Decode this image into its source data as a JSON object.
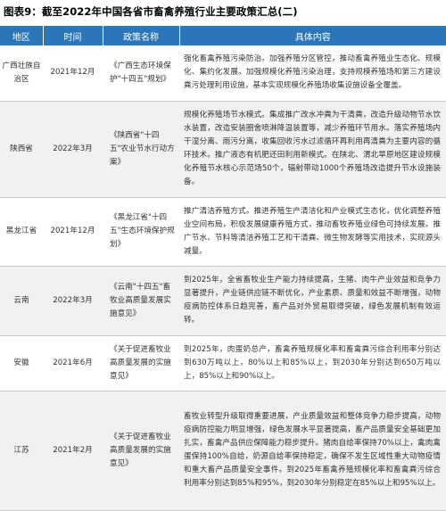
{
  "title": "图表9：截至2022年中国各省市畜禽养殖行业主要政策汇总(二)",
  "table": {
    "headers": [
      "地区",
      "时间",
      "政策名称",
      "具体内容"
    ],
    "rows": [
      {
        "region": "广西壮族自治区",
        "time": "2021年12月",
        "policy": "《广西生态环境保护\"十四五\"规划》",
        "content": "强化畜禽养殖污染防治。加强养殖分区管控，推动畜禽养殖业生态化、规模化、集约化发展。加强规模化养殖污染治理，支持规模养殖场和第三方建设粪污处理利用设施，基本实现规模化养殖场收集设施设备全覆盖。"
      },
      {
        "region": "陕西省",
        "time": "2022年3月",
        "policy": "《陕西省\"十四五\"农业节水行动方案》",
        "content": "规模化养殖场节水模式。集成推广改水冲粪为干清粪，改造升级动物节水饮水装置，改造安装圈舍喷淋降温装置等，减少养殖环节用水。落实养殖场内干湿分离、雨污分离，收集回收污水过滤循环再利用再清粪为主要内容的循环技术。推广液态有机肥还田利用新模式。在陕北、渭北旱原地区建设规模化养殖节水核心示范场50个，辐射带动1000个养殖场改造提升节水设施装备。"
      },
      {
        "region": "黑龙江省",
        "time": "2021年12月",
        "policy": "《黑龙江省\"十四五\"生态环境保护规划》",
        "content": "推广清洁养殖方式。推进养殖生产清洁化和产业模式生态化，优化调整养殖业空间布局，积极发展健康养殖方式，推动畜牧养殖业绿色可持续发展。推广节水、节料等清洁养殖工艺和干清粪、微生物发酵等实用技术，实现源头减量。"
      },
      {
        "region": "云南",
        "time": "2022年3月",
        "policy": "《云南\"十四五\"畜牧业高质量发展实施意见》",
        "content": "到2025年，全省畜牧业生产能力持续提高，生猪、肉牛产业效益和竞争力显著提升，产业链供应链不断优化，产业素质、质量和效益不断增强，动物疫病防控体系日趋完善，畜产品对外贸易取得突破，绿色发展机制有效运转。"
      },
      {
        "region": "安徽",
        "time": "2021年6月",
        "policy": "《关于促进畜牧业高质量发展的实施意见》",
        "content": "到2025年，肉蛋奶总产，畜禽养殖规模化率和畜禽粪污综合利用率分别达到630万吨以上，80%以上和85%以上，到2030年分别达到650万吨以上，85%以上和90%以上。"
      },
      {
        "region": "江苏",
        "time": "2021年2月",
        "policy": "《关于促进畜牧业高质量发展的实施意见》",
        "content": "畜牧业转型升级取得重要进展，产业质量效益和整体竞争力稳步提高，动物疫病防控能力明显增强，绿色发展水平显著提高，畜产品质量安全基础更加扎实，畜禽产品供应保障能力稳步提升。猪肉自给率保持70%以上，禽肉禽蛋保持100%自给，奶源自给率保持稳定，确保不发生区域性重大动物疫情和重大畜产品质量安全事件。到2025年畜禽养殖规模化率和畜禽粪污综合利用率分别达到85%和95%，到2030年分别稳定在85%以上和95%以上。"
      }
    ]
  }
}
